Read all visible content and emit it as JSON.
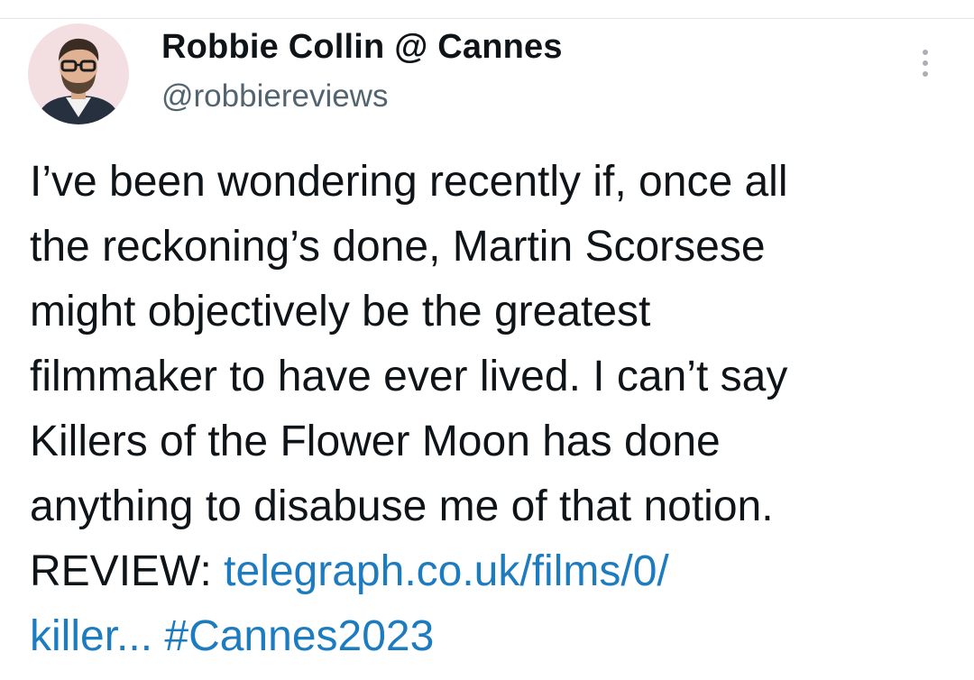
{
  "author": {
    "display_name": "Robbie Collin @ Cannes",
    "handle": "@robbiereviews",
    "avatar_icon": "profile-photo"
  },
  "menu": {
    "icon": "more-vertical-icon"
  },
  "tweet": {
    "lines": [
      "I’ve been wondering recently if, once all",
      "the reckoning’s done, Martin Scorsese",
      "might objectively be the greatest",
      "filmmaker to have ever lived. I can’t say",
      "Killers of the Flower Moon has done",
      "anything to disabuse me of that notion."
    ],
    "review_prefix": "REVIEW: ",
    "link_line1": "telegraph.co.uk/films/0/",
    "link_line2": "killer...",
    "hashtag": "#Cannes2023"
  },
  "colors": {
    "link": "#1d7bbf",
    "text": "#0f1419",
    "secondary_text": "#536471"
  }
}
